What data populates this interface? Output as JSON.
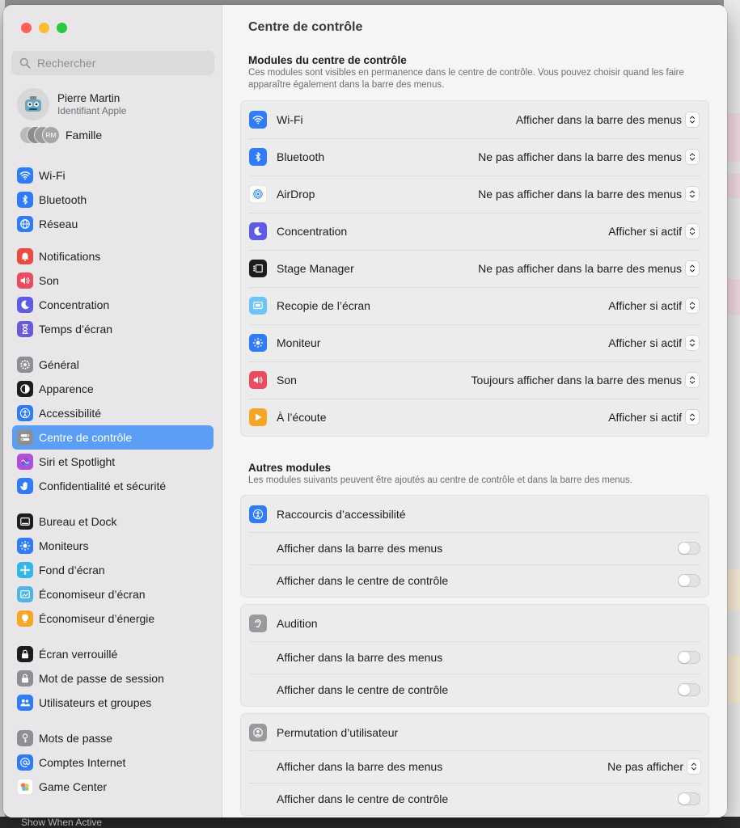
{
  "window": {
    "bottom_bar_label": "Show When Active"
  },
  "search": {
    "placeholder": "Rechercher"
  },
  "account": {
    "name": "Pierre Martin",
    "subtitle": "Identifiant Apple"
  },
  "family": {
    "label": "Famille",
    "avatar_initials": "RM"
  },
  "sidebar": {
    "items": [
      {
        "label": "Wi-Fi",
        "icon": "wifi-icon",
        "color": "#2f7cf6"
      },
      {
        "label": "Bluetooth",
        "icon": "bluetooth-icon",
        "color": "#2f7cf6"
      },
      {
        "label": "Réseau",
        "icon": "globe-icon",
        "color": "#2f7cf6"
      },
      {
        "label": "Notifications",
        "icon": "bell-icon",
        "color": "#eb4b3f"
      },
      {
        "label": "Son",
        "icon": "speaker-icon",
        "color": "#eb4b5e"
      },
      {
        "label": "Concentration",
        "icon": "moon-icon",
        "color": "#5e5ce6"
      },
      {
        "label": "Temps d’écran",
        "icon": "hourglass-icon",
        "color": "#6b5bd6"
      },
      {
        "label": "Général",
        "icon": "gear-icon",
        "color": "#8e8e93"
      },
      {
        "label": "Apparence",
        "icon": "appearance-icon",
        "color": "#1d1d1f"
      },
      {
        "label": "Accessibilité",
        "icon": "accessibility-icon",
        "color": "#2f7cf6"
      },
      {
        "label": "Centre de contrôle",
        "icon": "control-center-icon",
        "color": "#8e8e93"
      },
      {
        "label": "Siri et Spotlight",
        "icon": "siri-icon",
        "color": "#b04fd8"
      },
      {
        "label": "Confidentialité et sécurité",
        "icon": "hand-icon",
        "color": "#2f7cf6"
      },
      {
        "label": "Bureau et Dock",
        "icon": "dock-icon",
        "color": "#1d1d1f"
      },
      {
        "label": "Moniteurs",
        "icon": "sun-icon",
        "color": "#2f7cf6"
      },
      {
        "label": "Fond d’écran",
        "icon": "wallpaper-icon",
        "color": "#33b5e5"
      },
      {
        "label": "Économiseur d’écran",
        "icon": "screensaver-icon",
        "color": "#4fb4e8"
      },
      {
        "label": "Économiseur d’énergie",
        "icon": "bulb-icon",
        "color": "#f5a623"
      },
      {
        "label": "Écran verrouillé",
        "icon": "lock-screen-icon",
        "color": "#1d1d1f"
      },
      {
        "label": "Mot de passe de session",
        "icon": "lock-icon",
        "color": "#8e8e93"
      },
      {
        "label": "Utilisateurs et groupes",
        "icon": "users-icon",
        "color": "#2f7cf6"
      },
      {
        "label": "Mots de passe",
        "icon": "key-icon",
        "color": "#8e8e93"
      },
      {
        "label": "Comptes Internet",
        "icon": "at-icon",
        "color": "#2f7cf6"
      },
      {
        "label": "Game Center",
        "icon": "game-center-icon",
        "color": "#ffffff"
      }
    ]
  },
  "main": {
    "title": "Centre de contrôle",
    "modules_title": "Modules du centre de contrôle",
    "modules_desc": "Ces modules sont visibles en permanence dans le centre de contrôle. Vous pouvez choisir quand les faire apparaître également dans la barre des menus.",
    "modules": [
      {
        "label": "Wi-Fi",
        "value": "Afficher dans la barre des menus",
        "icon": "wifi-icon",
        "color": "#2f7cf6"
      },
      {
        "label": "Bluetooth",
        "value": "Ne pas afficher dans la barre des menus",
        "icon": "bluetooth-icon",
        "color": "#2f7cf6"
      },
      {
        "label": "AirDrop",
        "value": "Ne pas afficher dans la barre des menus",
        "icon": "airdrop-icon",
        "color": "#ffffff"
      },
      {
        "label": "Concentration",
        "value": "Afficher si actif",
        "icon": "moon-icon",
        "color": "#5e5ce6"
      },
      {
        "label": "Stage Manager",
        "value": "Ne pas afficher dans la barre des menus",
        "icon": "stage-manager-icon",
        "color": "#1d1d1f"
      },
      {
        "label": "Recopie de l’écran",
        "value": "Afficher si actif",
        "icon": "screen-mirroring-icon",
        "color": "#6cc3f5"
      },
      {
        "label": "Moniteur",
        "value": "Afficher si actif",
        "icon": "sun-icon",
        "color": "#2f7cf6"
      },
      {
        "label": "Son",
        "value": "Toujours afficher dans la barre des menus",
        "icon": "speaker-icon",
        "color": "#eb4b5e"
      },
      {
        "label": "À l’écoute",
        "value": "Afficher si actif",
        "icon": "now-playing-icon",
        "color": "#f5a623"
      }
    ],
    "other_title": "Autres modules",
    "other_desc": "Les modules suivants peuvent être ajoutés au centre de contrôle et dans la barre des menus.",
    "other_modules": [
      {
        "label": "Raccourcis d’accessibilité",
        "icon": "accessibility-icon",
        "color": "#2f7cf6",
        "rows": [
          {
            "label": "Afficher dans la barre des menus",
            "type": "toggle",
            "on": false
          },
          {
            "label": "Afficher dans le centre de contrôle",
            "type": "toggle",
            "on": false
          }
        ]
      },
      {
        "label": "Audition",
        "icon": "ear-icon",
        "color": "#9a9a9e",
        "rows": [
          {
            "label": "Afficher dans la barre des menus",
            "type": "toggle",
            "on": false
          },
          {
            "label": "Afficher dans le centre de contrôle",
            "type": "toggle",
            "on": false
          }
        ]
      },
      {
        "label": "Permutation d’utilisateur",
        "icon": "user-switch-icon",
        "color": "#9a9a9e",
        "rows": [
          {
            "label": "Afficher dans la barre des menus",
            "type": "select",
            "value": "Ne pas afficher"
          },
          {
            "label": "Afficher dans le centre de contrôle",
            "type": "toggle",
            "on": false
          }
        ]
      }
    ]
  }
}
